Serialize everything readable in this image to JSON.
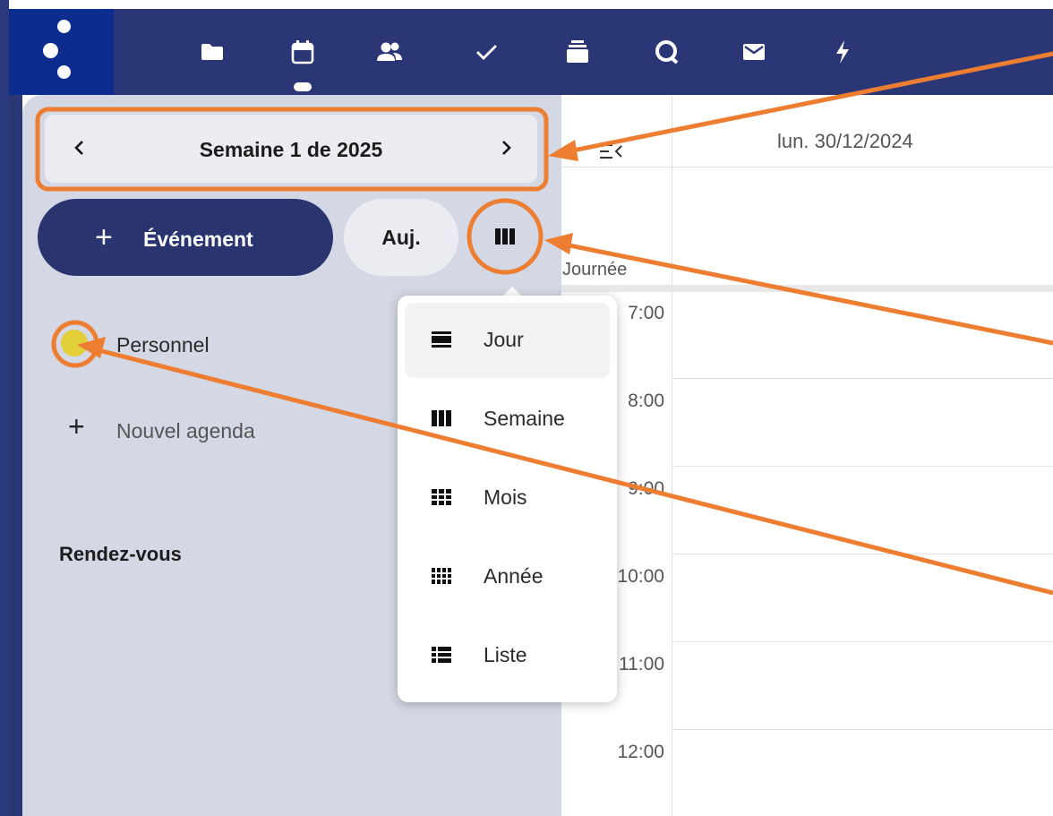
{
  "topbar": {
    "logo": "nextcloud-logo",
    "icons": [
      "files-icon",
      "calendar-icon",
      "contacts-icon",
      "tasks-icon",
      "deck-icon",
      "talk-icon",
      "mail-icon",
      "activity-icon"
    ],
    "active": "calendar-icon"
  },
  "sidebar": {
    "week_title": "Semaine 1 de 2025",
    "prev_icon": "chevron-left-icon",
    "next_icon": "chevron-right-icon",
    "new_event_plus": "+",
    "new_event_label": "Événement",
    "today_label": "Auj.",
    "view_icon": "view-week-icon",
    "calendars": [
      {
        "label": "Personnel",
        "color": "#e2cf3a"
      }
    ],
    "new_calendar_plus": "+",
    "new_calendar_label": "Nouvel agenda",
    "appointments_heading": "Rendez-vous"
  },
  "calendar": {
    "day_header": "lun. 30/12/2024",
    "allday_label": "Journée",
    "hours": [
      "7:00",
      "8:00",
      "9:00",
      "10:00",
      "11:00",
      "12:00"
    ]
  },
  "view_menu": {
    "items": [
      {
        "label": "Jour",
        "icon": "view-day-icon",
        "active": true
      },
      {
        "label": "Semaine",
        "icon": "view-week-icon",
        "active": false
      },
      {
        "label": "Mois",
        "icon": "view-month-icon",
        "active": false
      },
      {
        "label": "Année",
        "icon": "view-year-icon",
        "active": false
      },
      {
        "label": "Liste",
        "icon": "view-list-icon",
        "active": false
      }
    ]
  },
  "colors": {
    "topbar": "#2b3677",
    "logo_bg": "#0d2c8f",
    "primary_button": "#2a3570",
    "sidebar_bg": "#d4d8e4",
    "annotation": "#ed7d31"
  }
}
